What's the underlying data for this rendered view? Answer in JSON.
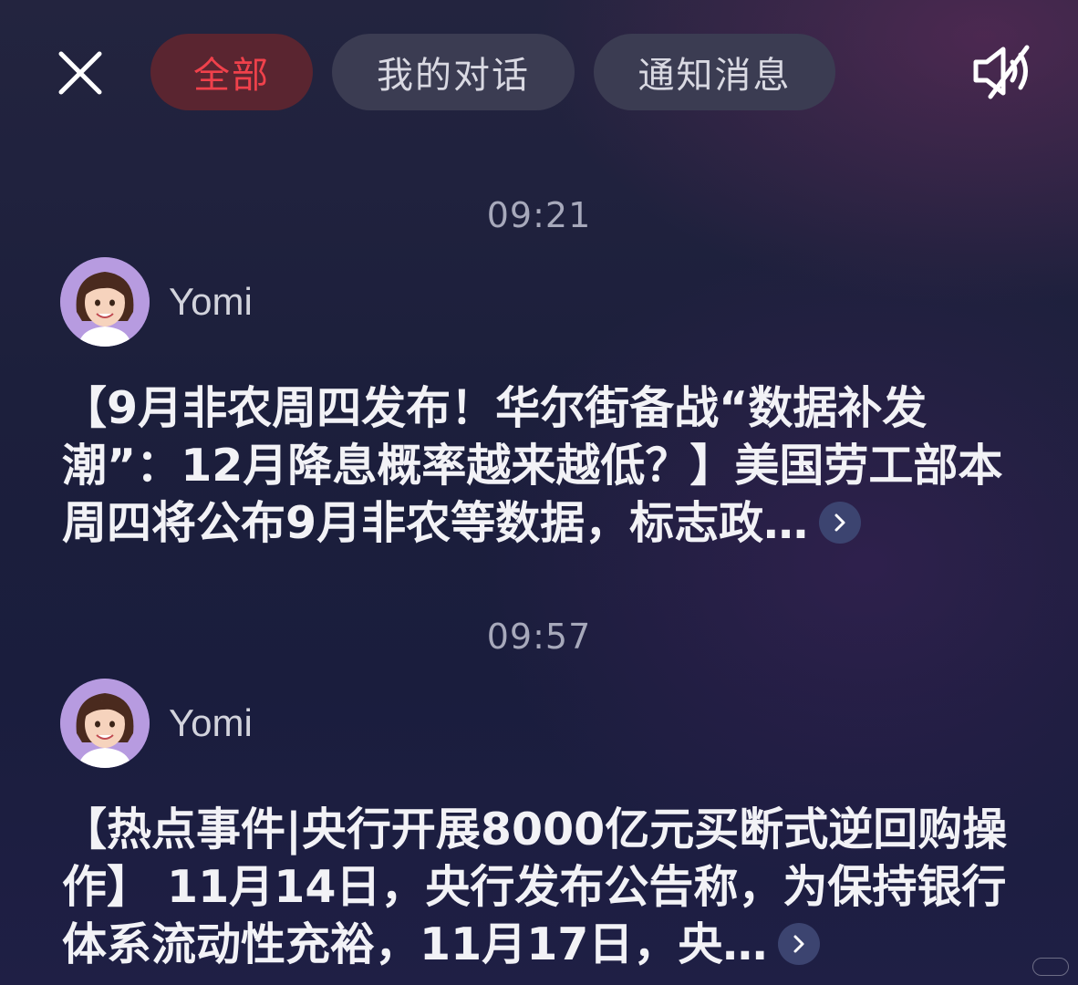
{
  "tabs": [
    {
      "label": "全部",
      "active": true
    },
    {
      "label": "我的对话",
      "active": false
    },
    {
      "label": "通知消息",
      "active": false
    }
  ],
  "icons": {
    "close": "close-icon",
    "mute": "speaker-muted-icon",
    "expand": "chevron-right-icon"
  },
  "colors": {
    "active_tab_text": "#f0414b",
    "active_tab_bg": "#5a2530",
    "inactive_tab_bg": "#3b3c52"
  },
  "messages": [
    {
      "time": "09:21",
      "sender": "Yomi",
      "text": "【9月非农周四发布！华尔街备战“数据补发潮”：12月降息概率越来越低？】美国劳工部本周四将公布9月非农等数据，标志政…"
    },
    {
      "time": "09:57",
      "sender": "Yomi",
      "text": "【热点事件|央行开展8000亿元买断式逆回购操作】 11月14日，央行发布公告称，为保持银行体系流动性充裕，11月17日，央…"
    }
  ]
}
